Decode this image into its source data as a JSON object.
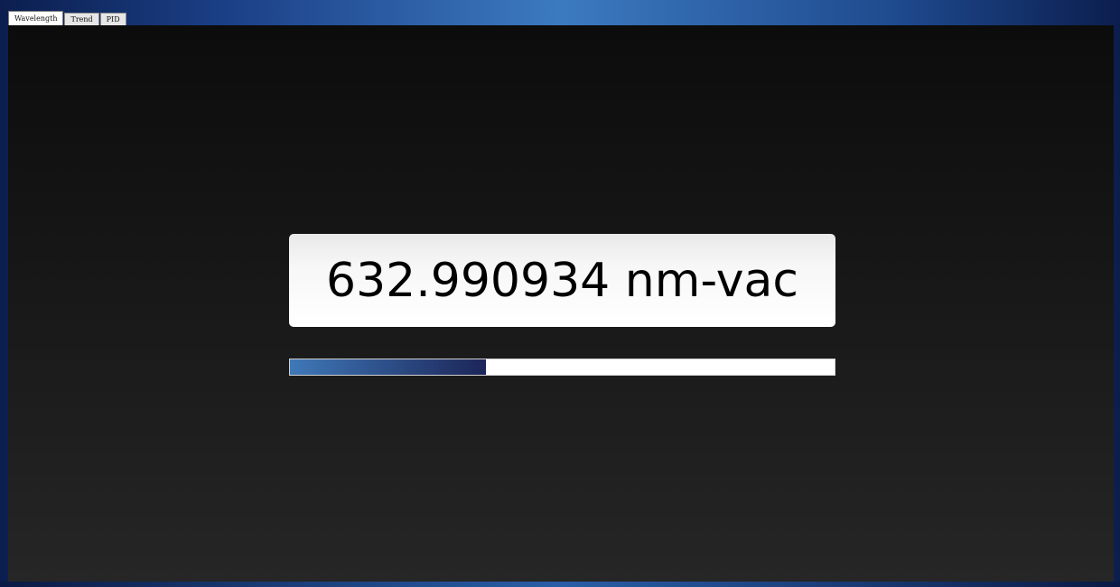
{
  "tabs": [
    {
      "label": "Wavelength",
      "active": true
    },
    {
      "label": "Trend",
      "active": false
    },
    {
      "label": "PID",
      "active": false
    }
  ],
  "readout": {
    "value": "632.990934 nm-vac"
  },
  "progress": {
    "fraction": 0.36,
    "fill_colors": [
      "#3f78b8",
      "#1c2558"
    ]
  },
  "colors": {
    "panel_background": "#1a1a1a",
    "window_frame": "#2a5ea8",
    "readout_background": "#ffffff"
  }
}
